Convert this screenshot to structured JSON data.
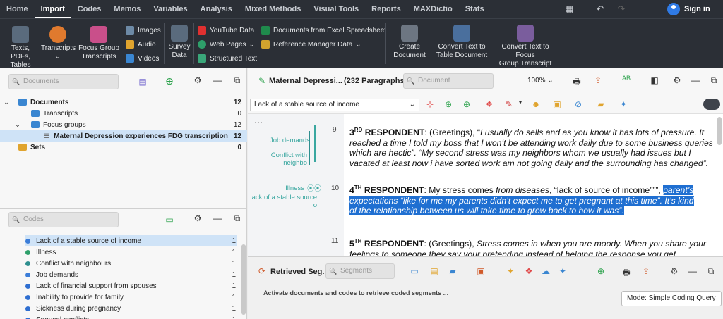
{
  "menu": [
    "Home",
    "Import",
    "Codes",
    "Memos",
    "Variables",
    "Analysis",
    "Mixed Methods",
    "Visual Tools",
    "Reports",
    "MAXDictio",
    "Stats"
  ],
  "menu_active": "Import",
  "signin_label": "Sign in",
  "ribbon": {
    "texts": "Texts, PDFs,\nTables",
    "transcripts": "Transcripts",
    "focus_group": "Focus Group\nTranscripts",
    "images": "Images",
    "audio": "Audio",
    "videos": "Videos",
    "survey": "Survey\nData",
    "youtube": "YouTube Data",
    "webpages": "Web Pages",
    "structured": "Structured Text",
    "excel": "Documents from Excel Spreadsheet",
    "refmgr": "Reference Manager Data",
    "create_doc": "Create\nDocument",
    "convert_table": "Convert Text to\nTable Document",
    "convert_focus": "Convert Text to Focus\nGroup Transcript"
  },
  "documents_panel": {
    "search_placeholder": "Documents",
    "tree": [
      {
        "label": "Documents",
        "count": "12"
      },
      {
        "label": "Transcripts",
        "count": "0"
      },
      {
        "label": "Focus groups",
        "count": "12"
      },
      {
        "label": "Maternal Depression experiences FDG transcription",
        "count": "12"
      },
      {
        "label": "Sets",
        "count": "0"
      }
    ]
  },
  "codes_panel": {
    "search_placeholder": "Codes",
    "items": [
      {
        "label": "Lack of a stable source of income",
        "count": "1"
      },
      {
        "label": "Illness",
        "count": "1"
      },
      {
        "label": "Conflict with neighbours",
        "count": "1"
      },
      {
        "label": "Job demands",
        "count": "1"
      },
      {
        "label": "Lack of financial support from spouses",
        "count": "1"
      },
      {
        "label": "Inability to provide for family",
        "count": "1"
      },
      {
        "label": "Sickness during pregnancy",
        "count": "1"
      },
      {
        "label": "Spousal conflicts",
        "count": "1"
      }
    ],
    "colors": [
      "#3b7dd8",
      "#2e9f6a",
      "#2e8f8f",
      "#3b7dd8",
      "#2f6fd1",
      "#2f6fd1",
      "#2f6fd1",
      "#2f6fd1"
    ]
  },
  "browser": {
    "title": "Maternal Depressi...",
    "paragraphs": "(232 Paragraphs)",
    "search_placeholder": "Document",
    "zoom": "100%",
    "code_dropdown": "Lack of a stable source of income",
    "codes_margin": [
      "Job demands",
      "Conflict with neighbo",
      "Illness",
      "Lack of a stable source o"
    ],
    "p9_num": "9",
    "p10_num": "10",
    "p11_num": "11",
    "p9_head": "3",
    "p9_sup": "RD",
    "p9_resp": " RESPONDENT",
    "p9_a": ": (Greetings), “",
    "p9_b": "I usually do sells and as you know it has lots of pressure. It reached a time I told my boss that I won’t be attending work daily due to some business queries which are hectic",
    "p9_c": "”. “My second stress was my neighbors whom we usually had issues but I vacated at least now i have sorted work am not going daily and the surrounding has changed”.",
    "p10_head": "4",
    "p10_sup": "TH",
    "p10_resp": " RESPONDENT",
    "p10_a": ": My stress comes ",
    "p10_b": "from diseases",
    "p10_c": ", “lack of source of income”””, ",
    "p10_hl1": "parent’s",
    "p10_hl2": "expectations “like for me my parents didn’t expect me to get pregnant at this time”. It’s kind",
    "p10_hl3": "of the relationship between us will take time to grow back to how it was”.",
    "p11_head": "5",
    "p11_sup": "TH",
    "p11_resp": " RESPONDENT",
    "p11_a": ": (Greetings), ",
    "p11_b": "Stress comes in when you are moody. When you share your feelings to someone they say your pretending instead of helping the response you get"
  },
  "retrieved": {
    "title": "Retrieved Seg...",
    "search_placeholder": "Segments",
    "message": "Activate documents and codes to retrieve coded segments ...",
    "mode": "Mode: Simple Coding Query"
  }
}
